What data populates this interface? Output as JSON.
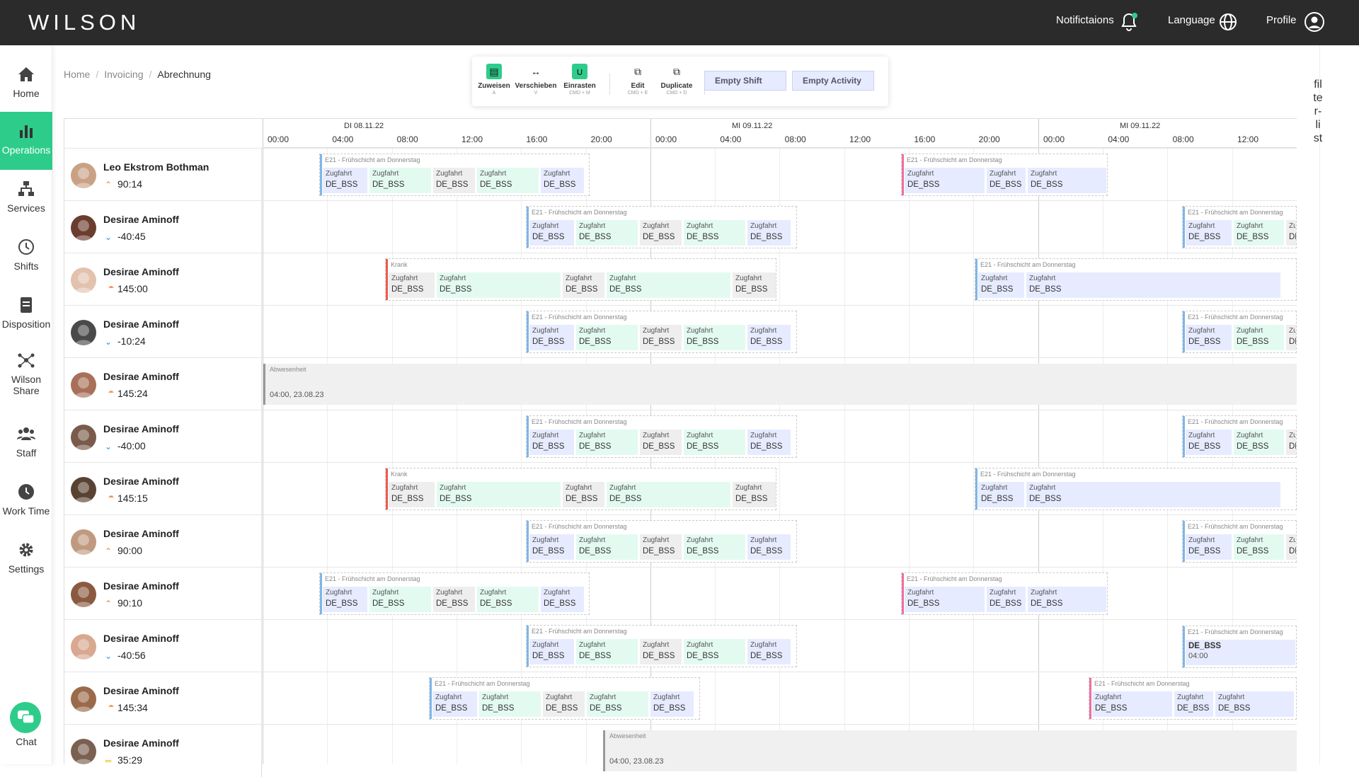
{
  "app": {
    "logo": "WILSON"
  },
  "topbar": {
    "notifications": "Notifictaions",
    "language": "Language",
    "profile": "Profile"
  },
  "sidebar": {
    "items": [
      {
        "label": "Home",
        "icon": "home-icon"
      },
      {
        "label": "Operations",
        "icon": "bar-chart-icon",
        "active": true
      },
      {
        "label": "Services",
        "icon": "sitemap-icon"
      },
      {
        "label": "Shifts",
        "icon": "clock-icon"
      },
      {
        "label": "Disposition",
        "icon": "document-icon"
      },
      {
        "label": "Wilson",
        "label2": "Share",
        "icon": "share-network-icon"
      },
      {
        "label": "Staff",
        "icon": "people-icon"
      },
      {
        "label": "Work Time",
        "icon": "clock-filled-icon"
      },
      {
        "label": "Settings",
        "icon": "gear-icon"
      }
    ],
    "chat": "Chat"
  },
  "breadcrumb": {
    "home": "Home",
    "invoicing": "Invoicing",
    "current": "Abrechnung"
  },
  "toolbar": {
    "zuweisen": {
      "label": "Zuweisen",
      "key": "A"
    },
    "verschieben": {
      "label": "Verschieben",
      "key": "V"
    },
    "einrasten": {
      "label": "Einrasten",
      "key": "CMD + M"
    },
    "edit": {
      "label": "Edit",
      "key": "CMD + E"
    },
    "duplicate": {
      "label": "Duplicate",
      "key": "CMD + D"
    },
    "empty_shift": "Empty Shift",
    "empty_activity": "Empty Activity"
  },
  "filter_label": "fil te r- li st",
  "timeline": {
    "days": [
      "DI 08.11.22",
      "MI 09.11.22",
      "MI 09.11.22"
    ],
    "hours": [
      "00:00",
      "04:00",
      "08:00",
      "12:00",
      "16:00",
      "20:00",
      "00:00",
      "04:00",
      "08:00",
      "12:00",
      "16:00",
      "20:00",
      "00:00",
      "04:00",
      "08:00",
      "12:00"
    ]
  },
  "labels": {
    "shift_title": "E21 - Frühschicht am Donnerstag",
    "krank": "Krank",
    "zugfahrt": "Zugfahrt",
    "code": "DE_BSS",
    "abwesenheit": "Abwesenheit",
    "abs_date": "04:00, 23.08.23",
    "time0400": "04:00"
  },
  "colors": {
    "accent": "#2ecc8a",
    "blue_bar": "#7fb6e8",
    "pink_bar": "#ee6fa0",
    "red_bar": "#ee5a4f",
    "grey_bar": "#9a9a9a",
    "up": "#f07a2a",
    "down": "#2d8fd8",
    "neutral": "#f0b400"
  },
  "employees": [
    {
      "name": "Leo Ekstrom Bothman",
      "hours": "90:14",
      "trend": "up"
    },
    {
      "name": "Desirae Aminoff",
      "hours": "-40:45",
      "trend": "down"
    },
    {
      "name": "Desirae Aminoff",
      "hours": "145:00",
      "trend": "double-up"
    },
    {
      "name": "Desirae Aminoff",
      "hours": "-10:24",
      "trend": "down"
    },
    {
      "name": "Desirae Aminoff",
      "hours": "145:24",
      "trend": "double-up"
    },
    {
      "name": "Desirae Aminoff",
      "hours": "-40:00",
      "trend": "down"
    },
    {
      "name": "Desirae Aminoff",
      "hours": "145:15",
      "trend": "double-up"
    },
    {
      "name": "Desirae Aminoff",
      "hours": "90:00",
      "trend": "up"
    },
    {
      "name": "Desirae Aminoff",
      "hours": "90:10",
      "trend": "up"
    },
    {
      "name": "Desirae Aminoff",
      "hours": "-40:56",
      "trend": "down"
    },
    {
      "name": "Desirae Aminoff",
      "hours": "145:34",
      "trend": "double-up"
    },
    {
      "name": "Desirae Aminoff",
      "hours": "35:29",
      "trend": "neutral"
    }
  ]
}
